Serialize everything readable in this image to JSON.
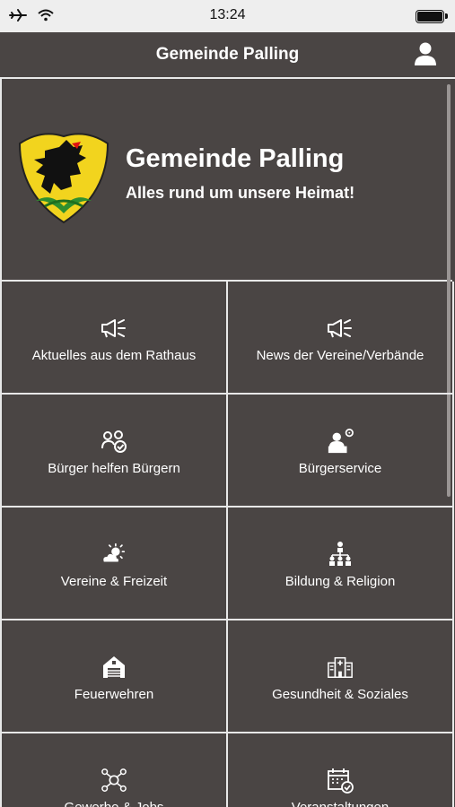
{
  "status_bar": {
    "time": "13:24"
  },
  "nav": {
    "title": "Gemeinde Palling",
    "user_icon": "user-icon"
  },
  "hero": {
    "title": "Gemeinde Palling",
    "subtitle": "Alles rund um unsere Heimat!",
    "crest_icon": "coat-of-arms"
  },
  "tiles": [
    {
      "label": "Aktuelles aus dem Rathaus",
      "icon": "megaphone-icon"
    },
    {
      "label": "News der Vereine/Verbände",
      "icon": "megaphone-icon"
    },
    {
      "label": "Bürger helfen Bürgern",
      "icon": "people-group-icon"
    },
    {
      "label": "Bürgerservice",
      "icon": "citizen-service-icon"
    },
    {
      "label": "Vereine & Freizeit",
      "icon": "sun-cloud-icon"
    },
    {
      "label": "Bildung & Religion",
      "icon": "hierarchy-people-icon"
    },
    {
      "label": "Feuerwehren",
      "icon": "fire-station-icon"
    },
    {
      "label": "Gesundheit & Soziales",
      "icon": "hospital-icon"
    },
    {
      "label": "Gewerbe & Jobs",
      "icon": "network-idea-icon"
    },
    {
      "label": "Veranstaltungen",
      "icon": "calendar-check-icon"
    }
  ]
}
